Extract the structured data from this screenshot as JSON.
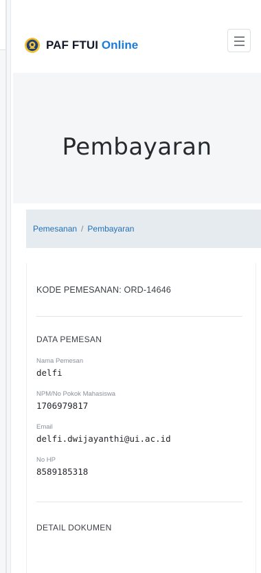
{
  "navbar": {
    "brand_prefix": "PAF FTUI ",
    "brand_accent": "Online",
    "logo_icon": "ui-makara-logo-icon",
    "menu_icon": "hamburger-menu-icon",
    "accent_color": "#1a7bd8"
  },
  "hero": {
    "title": "Pembayaran"
  },
  "breadcrumb": {
    "items": [
      "Pemesanan",
      "Pembayaran"
    ],
    "separator": "/"
  },
  "order": {
    "code_text": "KODE PEMESANAN: ORD-14646"
  },
  "customer": {
    "section_title": "DATA PEMESAN",
    "fields": [
      {
        "label": "Nama Pemesan",
        "value": "delfi"
      },
      {
        "label": "NPM/No Pokok Mahasiswa",
        "value": "1706979817"
      },
      {
        "label": "Email",
        "value": "delfi.dwijayanthi@ui.ac.id"
      },
      {
        "label": "No HP",
        "value": "8589185318"
      }
    ]
  },
  "documents": {
    "section_title": "DETAIL DOKUMEN"
  }
}
